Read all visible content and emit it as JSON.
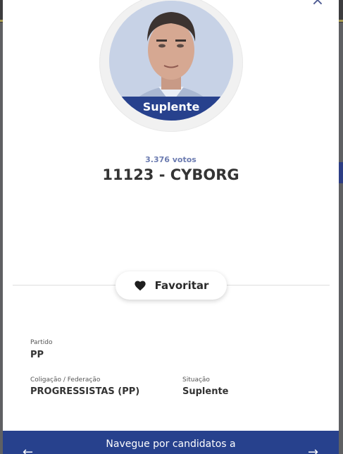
{
  "candidate": {
    "status_badge": "Suplente",
    "votes": "3.376 votos",
    "name": "11123 - CYBORG"
  },
  "actions": {
    "favorite_label": "Favoritar"
  },
  "details": {
    "party_label": "Partido",
    "party_value": "PP",
    "coalition_label": "Coligação / Federação",
    "coalition_value": "PROGRESSISTAS (PP)",
    "situation_label": "Situação",
    "situation_value": "Suplente"
  },
  "footer": {
    "navigate_text": "Navegue por candidatos a"
  },
  "icons": {
    "close": "close-icon",
    "favorite": "heart-icon",
    "prev": "arrow-left-icon",
    "next": "arrow-right-icon"
  },
  "colors": {
    "accent": "#27418d",
    "votes": "#6b7bb0"
  }
}
